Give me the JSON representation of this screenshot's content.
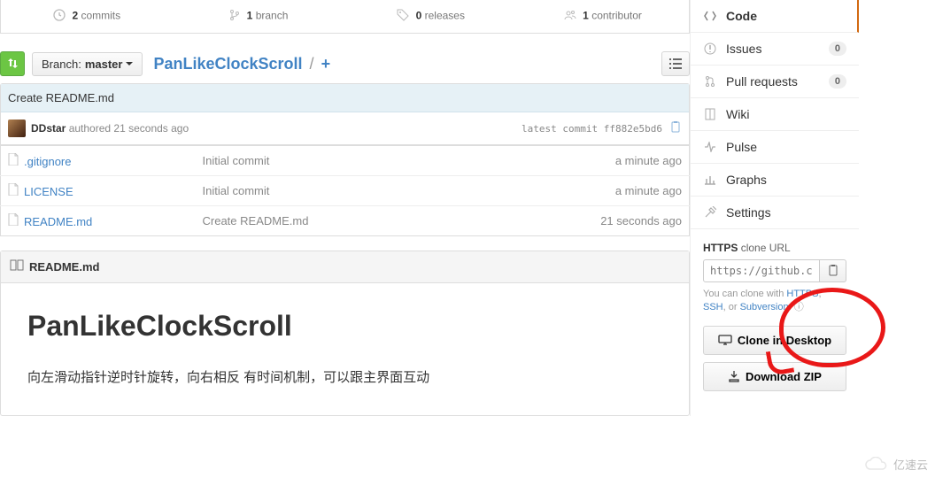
{
  "stats": {
    "commits": {
      "count": "2",
      "label": "commits"
    },
    "branch": {
      "count": "1",
      "label": "branch"
    },
    "releases": {
      "count": "0",
      "label": "releases"
    },
    "contributor": {
      "count": "1",
      "label": "contributor"
    }
  },
  "branch": {
    "label": "Branch:",
    "name": "master"
  },
  "breadcrumb": {
    "name": "PanLikeClockScroll",
    "sep": "/",
    "plus": "+"
  },
  "tease": {
    "message": "Create README.md",
    "author": "DDstar",
    "authored": "authored 21 seconds ago",
    "latest_label": "latest commit",
    "sha": "ff882e5bd6"
  },
  "files": [
    {
      "name": ".gitignore",
      "msg": "Initial commit",
      "age": "a minute ago"
    },
    {
      "name": "LICENSE",
      "msg": "Initial commit",
      "age": "a minute ago"
    },
    {
      "name": "README.md",
      "msg": "Create README.md",
      "age": "21 seconds ago"
    }
  ],
  "readme": {
    "filename": "README.md",
    "title": "PanLikeClockScroll",
    "body": "向左滑动指针逆时针旋转，向右相反 有时间机制，可以跟主界面互动"
  },
  "sidebar": {
    "nav": [
      {
        "label": "Code",
        "icon": "code-icon",
        "active": true
      },
      {
        "label": "Issues",
        "icon": "issues-icon",
        "count": "0"
      },
      {
        "label": "Pull requests",
        "icon": "pr-icon",
        "count": "0"
      },
      {
        "label": "Wiki",
        "icon": "wiki-icon"
      },
      {
        "label": "Pulse",
        "icon": "pulse-icon"
      },
      {
        "label": "Graphs",
        "icon": "graphs-icon"
      },
      {
        "label": "Settings",
        "icon": "settings-icon"
      }
    ],
    "clone": {
      "proto": "HTTPS",
      "label": "clone URL",
      "url": "https://github.c",
      "help_prefix": "You can clone with ",
      "help_https": "HTTPS",
      "help_ssh": "SSH",
      "help_or": ", or ",
      "help_svn": "Subversion",
      "help_period": ". ",
      "desktop": "Clone in Desktop",
      "download": "Download ZIP"
    }
  },
  "watermark": "亿速云"
}
